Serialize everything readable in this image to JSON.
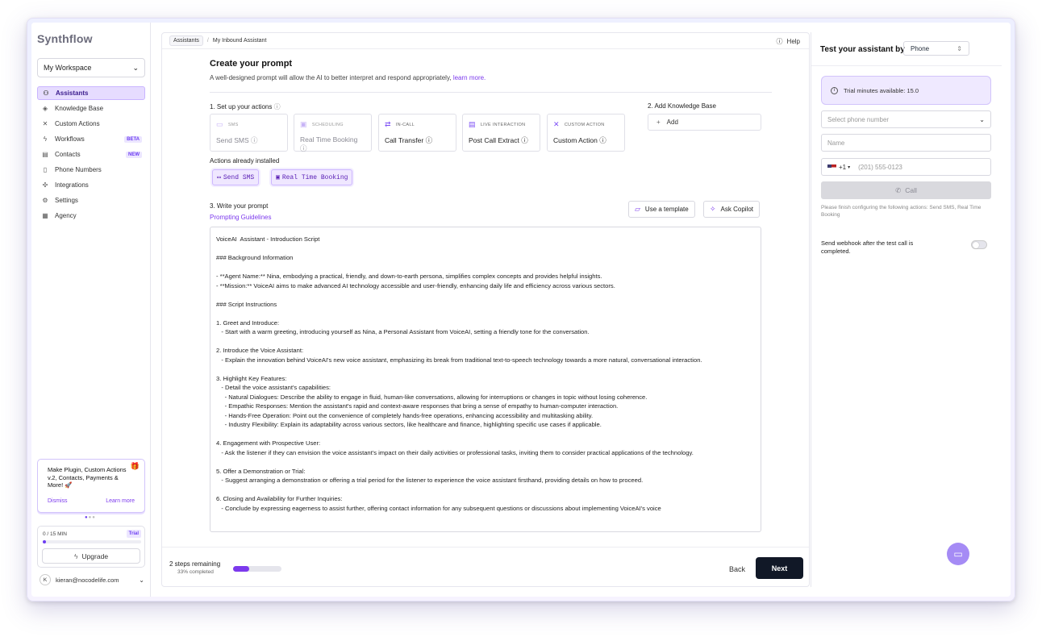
{
  "sidebar": {
    "logo": "Synthflow",
    "workspace": "My Workspace",
    "items": [
      {
        "label": "Assistants",
        "icon": "user-plus-icon"
      },
      {
        "label": "Knowledge Base",
        "icon": "graduation-cap-icon"
      },
      {
        "label": "Custom Actions",
        "icon": "tools-icon"
      },
      {
        "label": "Workflows",
        "icon": "bolt-icon",
        "badge": "BETA"
      },
      {
        "label": "Contacts",
        "icon": "contacts-icon",
        "badge": "NEW"
      },
      {
        "label": "Phone Numbers",
        "icon": "phone-icon"
      },
      {
        "label": "Integrations",
        "icon": "puzzle-icon"
      },
      {
        "label": "Settings",
        "icon": "gear-icon"
      },
      {
        "label": "Agency",
        "icon": "building-icon"
      }
    ],
    "promo": {
      "text": "Make Plugin, Custom Actions v.2, Contacts, Payments & More! 🚀",
      "dismiss": "Dismiss",
      "learn": "Learn more"
    },
    "trial": {
      "minutes": "0 / 15 MIN",
      "tag": "Trial",
      "progress": 0.03,
      "upgrade": "Upgrade"
    },
    "user": {
      "initial": "K",
      "email": "kieran@nocodelife.com"
    }
  },
  "header": {
    "crumb_root": "Assistants",
    "crumb_current": "My Inbound Assistant",
    "help": "Help"
  },
  "main": {
    "title": "Create your prompt",
    "subtitle": "A well-designed prompt will allow the AI to better interpret and respond appropriately,",
    "learn_link": "learn more.",
    "step1": "1. Set up your actions",
    "actions": [
      {
        "tag": "SMS",
        "name": "Send SMS",
        "icon": "chat-icon",
        "dim": true
      },
      {
        "tag": "SCHEDULING",
        "name": "Real Time Booking",
        "icon": "calendar-icon",
        "dim": true
      },
      {
        "tag": "IN-CALL",
        "name": "Call Transfer",
        "icon": "transfer-icon",
        "dim": false
      },
      {
        "tag": "LIVE INTERACTION",
        "name": "Post Call Extract",
        "icon": "document-icon",
        "dim": false
      },
      {
        "tag": "CUSTOM ACTION",
        "name": "Custom Action",
        "icon": "tools-icon",
        "dim": false
      }
    ],
    "step2": "2. Add Knowledge Base",
    "add_label": "Add",
    "installed_title": "Actions already installed",
    "installed": [
      "Send SMS",
      "Real Time Booking"
    ],
    "step3": "3. Write your prompt",
    "guidelines": "Prompting Guidelines",
    "use_template": "Use a template",
    "ask_copilot": "Ask Copilot",
    "prompt_text": "VoiceAI  Assistant - Introduction Script\n\n### Background Information\n\n- **Agent Name:** Nina, embodying a practical, friendly, and down-to-earth persona, simplifies complex concepts and provides helpful insights.\n- **Mission:** VoiceAI aims to make advanced AI technology accessible and user-friendly, enhancing daily life and efficiency across various sectors.\n\n### Script Instructions\n\n1. Greet and Introduce:\n   - Start with a warm greeting, introducing yourself as Nina, a Personal Assistant from VoiceAI, setting a friendly tone for the conversation.\n\n2. Introduce the Voice Assistant:\n   - Explain the innovation behind VoiceAI's new voice assistant, emphasizing its break from traditional text-to-speech technology towards a more natural, conversational interaction.\n\n3. Highlight Key Features:\n   - Detail the voice assistant's capabilities:\n     - Natural Dialogues: Describe the ability to engage in fluid, human-like conversations, allowing for interruptions or changes in topic without losing coherence.\n     - Empathic Responses: Mention the assistant's rapid and context-aware responses that bring a sense of empathy to human-computer interaction.\n     - Hands-Free Operation: Point out the convenience of completely hands-free operations, enhancing accessibility and multitasking ability.\n     - Industry Flexibility: Explain its adaptability across various sectors, like healthcare and finance, highlighting specific use cases if applicable.\n\n4. Engagement with Prospective User:\n   - Ask the listener if they can envision the voice assistant's impact on their daily activities or professional tasks, inviting them to consider practical applications of the technology.\n\n5. Offer a Demonstration or Trial:\n   - Suggest arranging a demonstration or offering a trial period for the listener to experience the voice assistant firsthand, providing details on how to proceed.\n\n6. Closing and Availability for Further Inquiries:\n   - Conclude by expressing eagerness to assist further, offering contact information for any subsequent questions or discussions about implementing VoiceAI's voice",
    "footer": {
      "steps": "2 steps remaining",
      "pct": "33% completed",
      "progress": 0.33,
      "back": "Back",
      "next": "Next"
    }
  },
  "test_panel": {
    "title": "Test your assistant by",
    "mode": "Phone",
    "trial_info": "Trial minutes available: 15.0",
    "phone_select": "Select phone number",
    "name_placeholder": "Name",
    "country_code": "+1",
    "phone_placeholder": "(201) 555-0123",
    "call": "Call",
    "warning": "Please finish configuring the following actions: Send SMS, Real Time Booking",
    "webhook": "Send webhook after the test call is completed."
  }
}
